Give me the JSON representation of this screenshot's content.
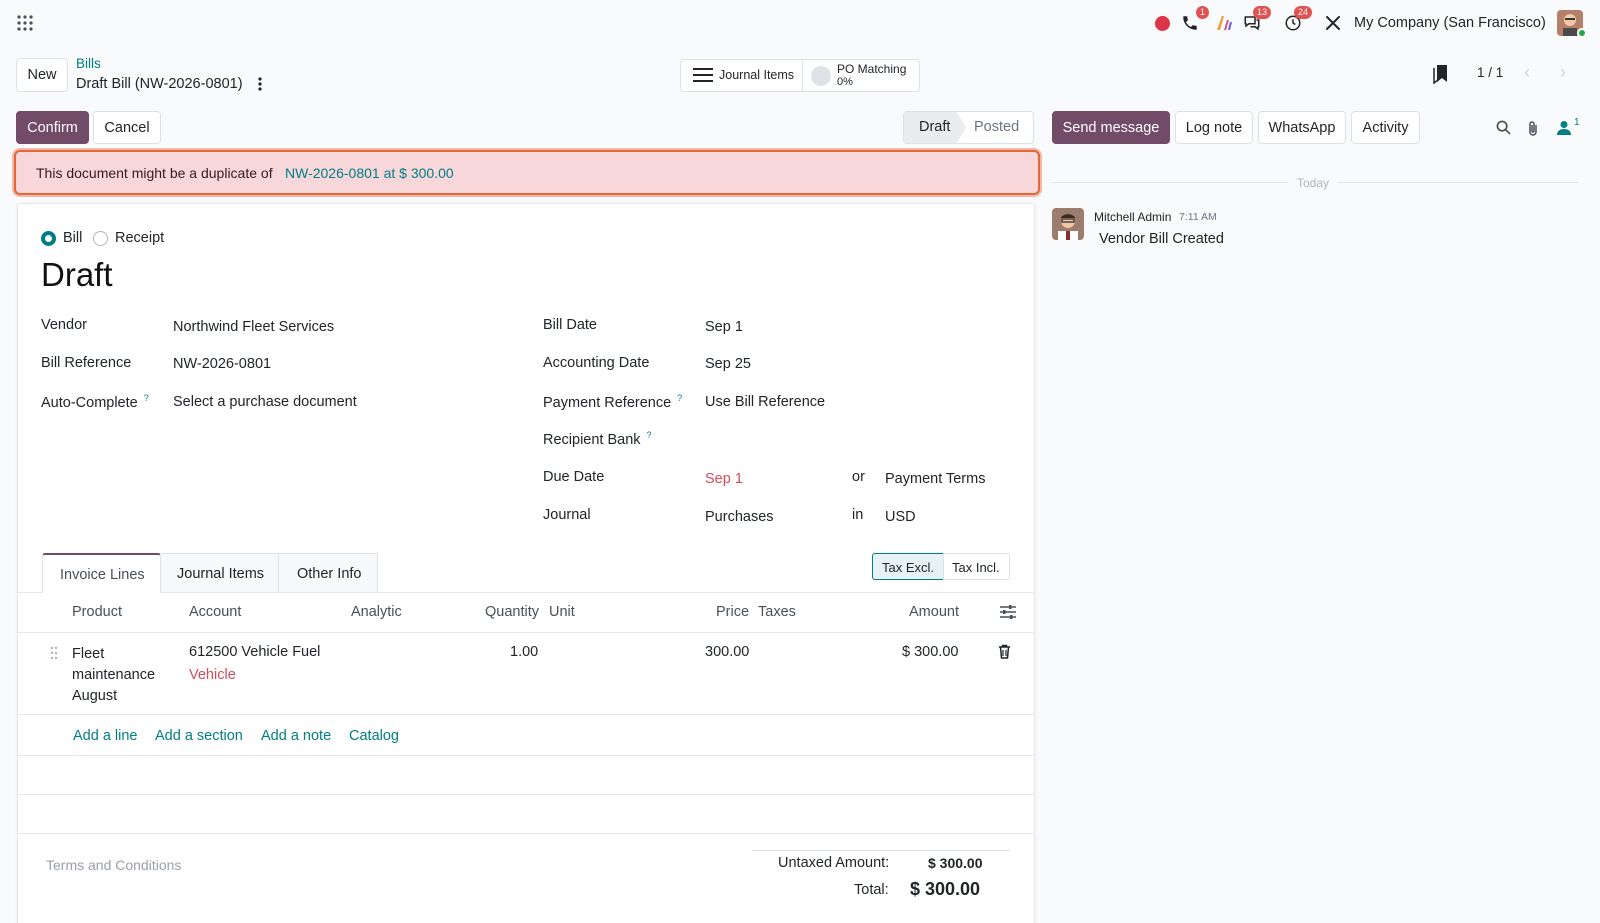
{
  "topbar": {
    "company": "My Company (San Francisco)",
    "badges": {
      "phone": "1",
      "chat": "13",
      "activity": "24"
    }
  },
  "header": {
    "new_label": "New",
    "breadcrumb_parent": "Bills",
    "record_title": "Draft Bill (NW-2026-0801)",
    "pager": "1 / 1"
  },
  "smart_buttons": {
    "journal_items": "Journal Items",
    "po_matching_label": "PO Matching",
    "po_matching_value": "0%"
  },
  "actions": {
    "confirm": "Confirm",
    "cancel": "Cancel"
  },
  "statusbar": {
    "draft": "Draft",
    "posted": "Posted"
  },
  "alert": {
    "text": "This document might be a duplicate of",
    "link": "NW-2026-0801 at $ 300.00"
  },
  "form": {
    "type_bill": "Bill",
    "type_receipt": "Receipt",
    "state_title": "Draft",
    "vendor_label": "Vendor",
    "vendor_value": "Northwind Fleet Services",
    "bill_ref_label": "Bill Reference",
    "bill_ref_value": "NW-2026-0801",
    "autocomplete_label": "Auto-Complete",
    "autocomplete_placeholder": "Select a purchase document",
    "bill_date_label": "Bill Date",
    "bill_date_value": "Sep 1",
    "acc_date_label": "Accounting Date",
    "acc_date_value": "Sep 25",
    "pay_ref_label": "Payment Reference",
    "pay_ref_placeholder": "Use Bill Reference",
    "recipient_bank_label": "Recipient Bank",
    "due_date_label": "Due Date",
    "due_date_value": "Sep 1",
    "or_label": "or",
    "payment_terms_placeholder": "Payment Terms",
    "journal_label": "Journal",
    "journal_value": "Purchases",
    "in_label": "in",
    "currency_value": "USD"
  },
  "tabs": {
    "invoice_lines": "Invoice Lines",
    "journal_items": "Journal Items",
    "other_info": "Other Info"
  },
  "tax_toggle": {
    "excl": "Tax Excl.",
    "incl": "Tax Incl."
  },
  "table": {
    "headers": {
      "product": "Product",
      "account": "Account",
      "analytic": "Analytic",
      "quantity": "Quantity",
      "unit": "Unit",
      "price": "Price",
      "taxes": "Taxes",
      "amount": "Amount"
    },
    "rows": [
      {
        "product_line1": "Fleet",
        "product_line2": "maintenance",
        "product_line3": "August",
        "account": "612500 Vehicle Fuel",
        "analytic_tag": "Vehicle",
        "quantity": "1.00",
        "price": "300.00",
        "amount": "$ 300.00"
      }
    ],
    "add_line": "Add a line",
    "add_section": "Add a section",
    "add_note": "Add a note",
    "catalog": "Catalog"
  },
  "footer": {
    "terms_placeholder": "Terms and Conditions",
    "untaxed_label": "Untaxed Amount:",
    "untaxed_value": "$ 300.00",
    "total_label": "Total:",
    "total_value": "$ 300.00"
  },
  "chatter": {
    "send_message": "Send message",
    "log_note": "Log note",
    "whatsapp": "WhatsApp",
    "activity": "Activity",
    "followers_count": "1",
    "date_separator": "Today",
    "message_author": "Mitchell Admin",
    "message_time": "7:11 AM",
    "message_body": "Vendor Bill Created"
  },
  "colors": {
    "primary": "#714b67",
    "link": "#017e84",
    "alert_bg": "#f8d7da",
    "alert_border": "#e0683b",
    "danger": "#d44c59"
  }
}
